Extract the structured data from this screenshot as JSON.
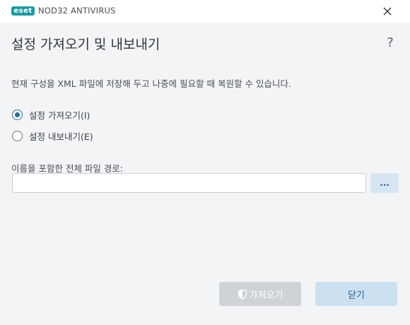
{
  "titlebar": {
    "logo_text": "eset",
    "app_name": "NOD32 ANTIVIRUS",
    "close_icon": "close-icon"
  },
  "dialog": {
    "title": "설정 가져오기 및 내보내기",
    "help_label": "?",
    "description": "현재 구성을 XML 파일에 저장해 두고 나중에 필요할 때 복원할 수 있습니다.",
    "options": [
      {
        "label": "설정 가져오기(I)",
        "selected": true
      },
      {
        "label": "설정 내보내기(E)",
        "selected": false
      }
    ],
    "path_label": "이름을 포함한 전체 파일 경로:",
    "path_value": "",
    "browse_label": "...",
    "import_button": "가져오기",
    "import_icon": "shield-icon",
    "close_button": "닫기"
  },
  "colors": {
    "accent": "#1f6f9e",
    "logo": "#1a9ba0",
    "background": "#f3f4f6"
  }
}
